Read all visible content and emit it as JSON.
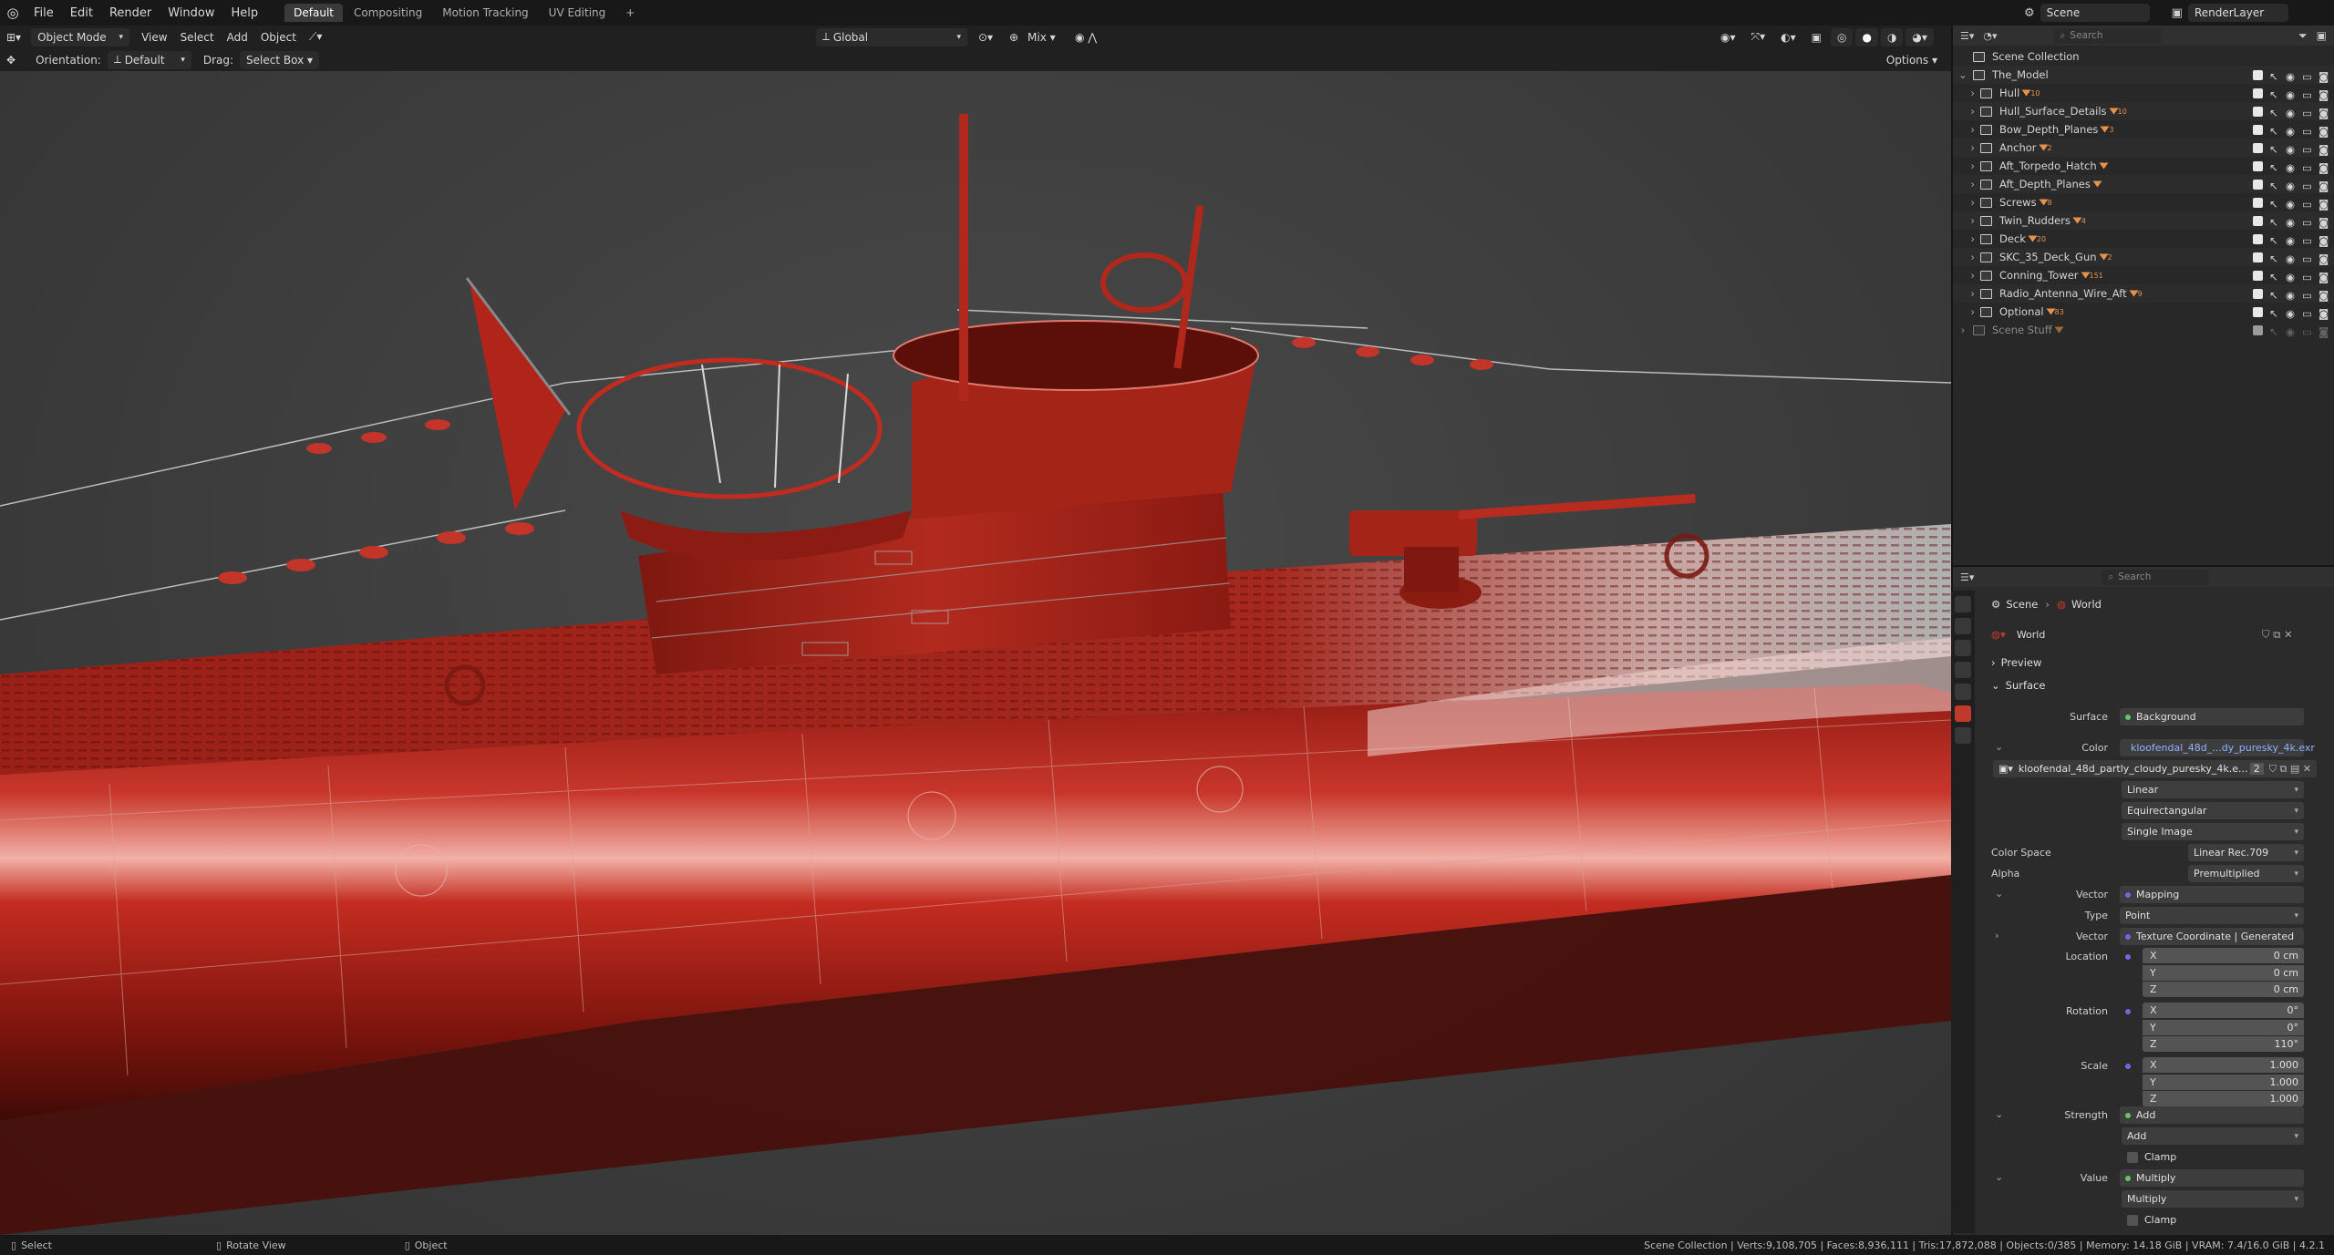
{
  "topbar": {
    "menus": [
      "File",
      "Edit",
      "Render",
      "Window",
      "Help"
    ],
    "workspaces": [
      "Default",
      "Compositing",
      "Motion Tracking",
      "UV Editing"
    ],
    "active_workspace": "Default",
    "add_tab": "+",
    "scene_label": "Scene",
    "view_layer_label": "RenderLayer"
  },
  "viewport_header": {
    "mode": "Object Mode",
    "menus": [
      "View",
      "Select",
      "Add",
      "Object"
    ],
    "transform_orientation": "Global",
    "proportional": "Mix",
    "orientation_label": "Orientation:",
    "orientation_value": "Default",
    "drag_label": "Drag:",
    "drag_value": "Select Box",
    "options_label": "Options"
  },
  "outliner": {
    "search_placeholder": "Search",
    "root": "Scene Collection",
    "collection": "The_Model",
    "items": [
      {
        "name": "Hull",
        "badge": "10"
      },
      {
        "name": "Hull_Surface_Details",
        "badge": "10"
      },
      {
        "name": "Bow_Depth_Planes",
        "badge": "3"
      },
      {
        "name": "Anchor",
        "badge": "2"
      },
      {
        "name": "Aft_Torpedo_Hatch",
        "badge": ""
      },
      {
        "name": "Aft_Depth_Planes",
        "badge": ""
      },
      {
        "name": "Screws",
        "badge": "8"
      },
      {
        "name": "Twin_Rudders",
        "badge": "4"
      },
      {
        "name": "Deck",
        "badge": "20"
      },
      {
        "name": "SKC_35_Deck_Gun",
        "badge": "2"
      },
      {
        "name": "Conning_Tower",
        "badge": "151"
      },
      {
        "name": "Radio_Antenna_Wire_Aft",
        "badge": "9"
      },
      {
        "name": "Optional",
        "badge": "83"
      }
    ],
    "extra_collection": "Scene Stuff"
  },
  "properties": {
    "search_placeholder": "Search",
    "breadcrumb": [
      "Scene",
      "World"
    ],
    "world_name": "World",
    "preview_panel": "Preview",
    "surface_panel": "Surface",
    "fields": {
      "surface_label": "Surface",
      "surface_value": "Background",
      "color_label": "Color",
      "color_value": "kloofendal_48d_...dy_puresky_4k.exr",
      "image_name": "kloofendal_48d_partly_cloudy_puresky_4k.e...",
      "image_users": "2",
      "interpolation": "Linear",
      "projection": "Equirectangular",
      "source": "Single Image",
      "color_space_label": "Color Space",
      "color_space_value": "Linear Rec.709",
      "alpha_label": "Alpha",
      "alpha_value": "Premultiplied",
      "vector_label": "Vector",
      "vector_value": "Mapping",
      "type_label": "Type",
      "type_value": "Point",
      "vector2_label": "Vector",
      "vector2_value": "Texture Coordinate | Generated",
      "location_label": "Location",
      "loc_x": "0 cm",
      "loc_y": "0 cm",
      "loc_z": "0 cm",
      "rotation_label": "Rotation",
      "rot_x": "0°",
      "rot_y": "0°",
      "rot_z": "110°",
      "scale_label": "Scale",
      "scale_x": "1.000",
      "scale_y": "1.000",
      "scale_z": "1.000",
      "axis_x": "X",
      "axis_y": "Y",
      "axis_z": "Z",
      "strength_label": "Strength",
      "strength_value": "Add",
      "strength_op": "Add",
      "clamp1": "Clamp",
      "value_label": "Value",
      "value_value": "Multiply",
      "value_op": "Multiply",
      "clamp2": "Clamp"
    }
  },
  "statusbar": {
    "select": "Select",
    "rotate": "Rotate View",
    "object": "Object",
    "stats": "Scene Collection | Verts:9,108,705 | Faces:8,936,111 | Tris:17,872,088 | Objects:0/385 | Memory: 14.18 GiB | VRAM: 7.4/16.0 GiB | 4.2.1"
  },
  "colors": {
    "hull_red": "#b0241a",
    "accent_blue": "#4772b3",
    "orange_icon": "#e6924a"
  }
}
